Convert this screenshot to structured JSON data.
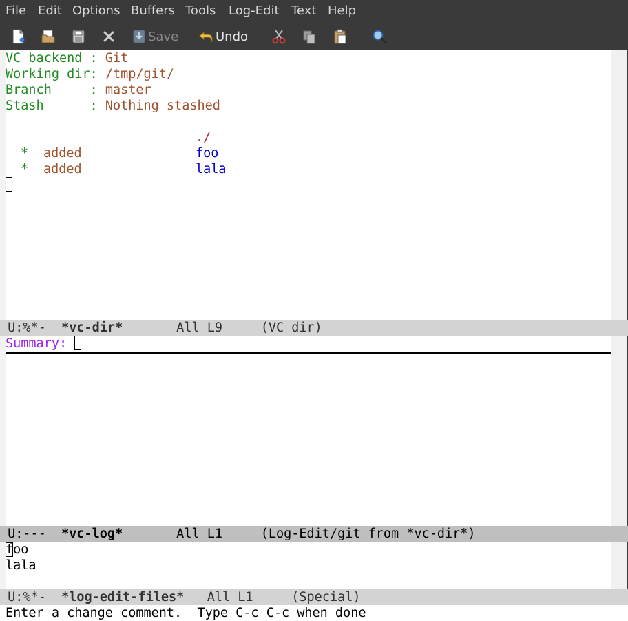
{
  "menubar": [
    "File",
    "Edit",
    "Options",
    "Buffers",
    "Tools",
    "Log-Edit",
    "Text",
    "Help"
  ],
  "toolbar": {
    "save_label": "Save",
    "undo_label": "Undo",
    "icons": [
      "new-file-icon",
      "open-folder-icon",
      "save-icon",
      "close-icon",
      "save-icon",
      "undo-icon",
      "cut-icon",
      "copy-icon",
      "paste-icon",
      "search-icon"
    ]
  },
  "vcdir": {
    "header": [
      {
        "key": "VC backend ",
        "sep": ": ",
        "value": "Git"
      },
      {
        "key": "Working dir",
        "sep": ": ",
        "value": "/tmp/git/"
      },
      {
        "key": "Branch     ",
        "sep": ": ",
        "value": "master"
      },
      {
        "key": "Stash      ",
        "sep": ": ",
        "value": "Nothing stashed"
      }
    ],
    "dir_line": "./",
    "files": [
      {
        "mark": "*",
        "state": "added",
        "name": "foo"
      },
      {
        "mark": "*",
        "state": "added",
        "name": "lala"
      }
    ],
    "modeline": {
      "status": "U:%*-  ",
      "buffer": "*vc-dir*",
      "position": "       All L9     ",
      "mode": "(VC dir)"
    }
  },
  "vclog": {
    "summary_label": "Summary: ",
    "modeline": {
      "status": "U:---  ",
      "buffer": "*vc-log*",
      "position": "       All L1     ",
      "mode": "(Log-Edit/git from *vc-dir*)"
    }
  },
  "logfiles": {
    "lines": [
      "foo",
      "lala"
    ],
    "modeline": {
      "status": "U:%*-  ",
      "buffer": "*log-edit-files*",
      "position": "   All L1     ",
      "mode": "(Special)"
    }
  },
  "minibuffer": "Enter a change comment.  Type C-c C-c when done",
  "colors": {
    "bar_bg": "#3a3a3a",
    "keyword": "#228b22",
    "value": "#a0522d",
    "filename": "#0000cd",
    "prompt": "#a020f0"
  }
}
